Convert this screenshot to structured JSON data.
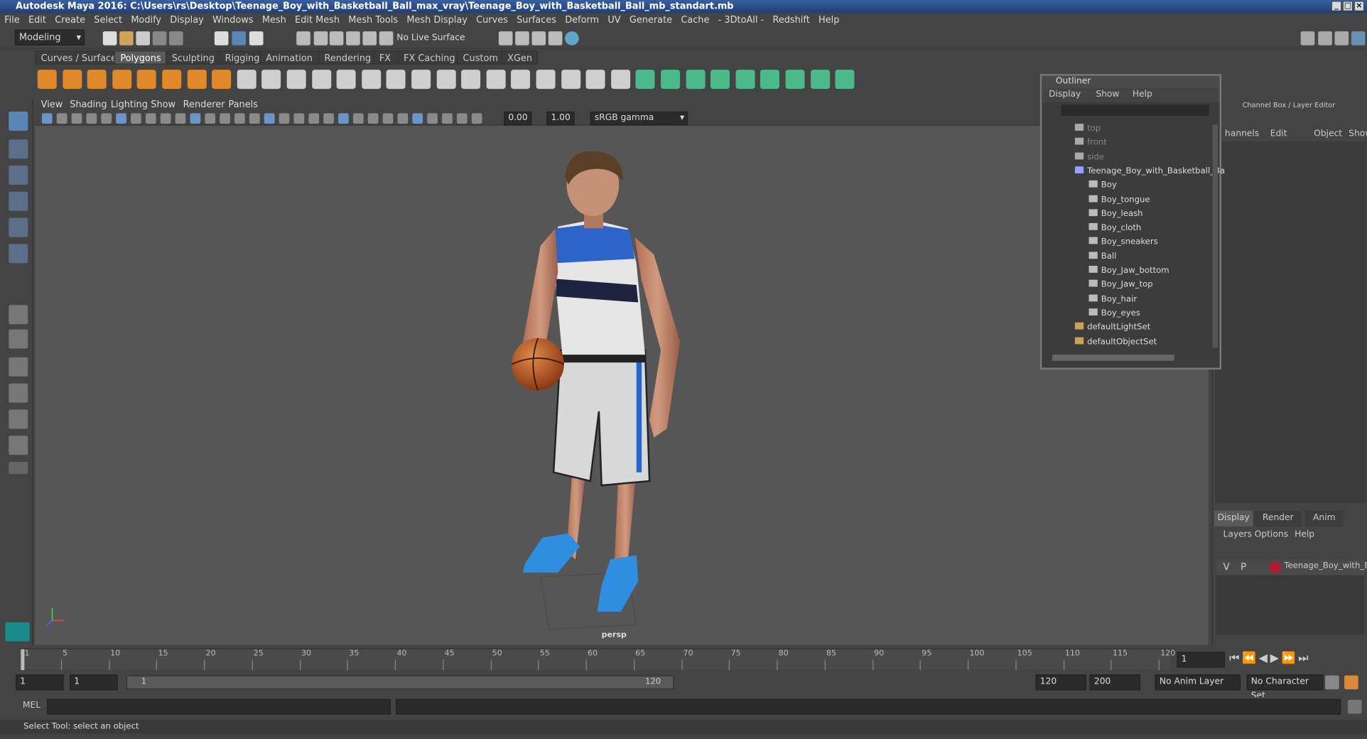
{
  "window": {
    "title": "Autodesk Maya 2016: C:\\Users\\rs\\Desktop\\Teenage_Boy_with_Basketball_Ball_max_vray\\Teenage_Boy_with_Basketball_Ball_mb_standart.mb"
  },
  "menu": [
    "File",
    "Edit",
    "Create",
    "Select",
    "Modify",
    "Display",
    "Windows",
    "Mesh",
    "Edit Mesh",
    "Mesh Tools",
    "Mesh Display",
    "Curves",
    "Surfaces",
    "Deform",
    "UV",
    "Generate",
    "Cache",
    "- 3DtoAll -",
    "Redshift",
    "Help"
  ],
  "toolbar": {
    "mode": "Modeling",
    "live_surface": "No Live Surface"
  },
  "shelf_tabs": [
    "Curves / Surfaces",
    "Polygons",
    "Sculpting",
    "Rigging",
    "Animation",
    "Rendering",
    "FX",
    "FX Caching",
    "Custom",
    "XGen"
  ],
  "viewport": {
    "menu": [
      "View",
      "Shading",
      "Lighting",
      "Show",
      "Renderer",
      "Panels"
    ],
    "exposure": "0.00",
    "gamma": "1.00",
    "colorspace": "sRGB gamma",
    "camera_label": "persp"
  },
  "outliner": {
    "title": "Outliner",
    "menu": [
      "Display",
      "Show",
      "Help"
    ],
    "items": [
      "top",
      "front",
      "side",
      "Teenage_Boy_with_Basketball_Ba",
      "Boy",
      "Boy_tongue",
      "Boy_leash",
      "Boy_cloth",
      "Boy_sneakers",
      "Ball",
      "Boy_Jaw_bottom",
      "Boy_Jaw_top",
      "Boy_hair",
      "Boy_eyes",
      "defaultLightSet",
      "defaultObjectSet"
    ]
  },
  "channel_box": {
    "title": "Channel Box / Layer Editor",
    "menu": [
      "hannels",
      "Edit",
      "Object",
      "Show"
    ]
  },
  "layer_editor": {
    "tabs": [
      "Display",
      "Render",
      "Anim"
    ],
    "menu": [
      "Layers",
      "Options",
      "Help"
    ],
    "layer": {
      "v": "V",
      "p": "P",
      "name": "Teenage_Boy_with_Ba:"
    }
  },
  "timeline": {
    "ticks": [
      "1",
      "5",
      "10",
      "15",
      "20",
      "25",
      "30",
      "35",
      "40",
      "45",
      "50",
      "55",
      "60",
      "65",
      "70",
      "75",
      "80",
      "85",
      "90",
      "95",
      "100",
      "105",
      "110",
      "115",
      "120"
    ],
    "current": "1"
  },
  "range": {
    "start": "1",
    "start2": "1",
    "slider_start": "1",
    "slider_end": "120",
    "end": "120",
    "end2": "200",
    "anim_layer": "No Anim Layer",
    "char_set": "No Character Set"
  },
  "command": {
    "label": "MEL"
  },
  "status": "Select Tool: select an object",
  "colors": {
    "title_bar": "#2a4d8c",
    "viewport": "#565656",
    "shelf_orange": "#e0892b",
    "layer_red": "#b01c2e"
  }
}
